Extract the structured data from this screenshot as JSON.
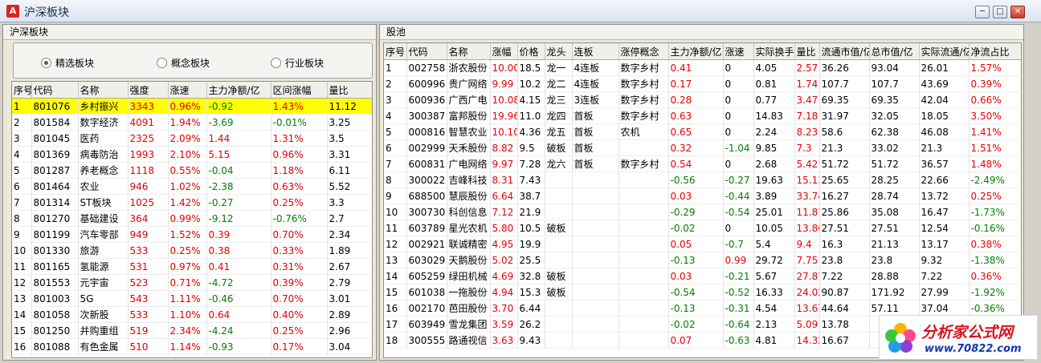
{
  "window": {
    "icon_text": "A",
    "title": "沪深板块",
    "min": "─",
    "max": "□",
    "close": "✕"
  },
  "left": {
    "title": "沪深板块",
    "radios": [
      {
        "label": "精选板块",
        "selected": true
      },
      {
        "label": "概念板块",
        "selected": false
      },
      {
        "label": "行业板块",
        "selected": false
      }
    ],
    "columns": [
      "序号",
      "代码",
      "名称",
      "强度",
      "涨速",
      "主力净额/亿",
      "区间涨幅",
      "量比"
    ],
    "rows": [
      [
        "1",
        "801076",
        "乡村振兴",
        "3343",
        "0.96%",
        "-0.92",
        "1.43%",
        "11.12"
      ],
      [
        "2",
        "801584",
        "数字经济",
        "4091",
        "1.94%",
        "-3.69",
        "-0.01%",
        "3.25"
      ],
      [
        "3",
        "801045",
        "医药",
        "2325",
        "2.09%",
        "1.44",
        "1.31%",
        "3.5"
      ],
      [
        "4",
        "801369",
        "病毒防治",
        "1993",
        "2.10%",
        "5.15",
        "0.96%",
        "3.31"
      ],
      [
        "5",
        "801287",
        "养老概念",
        "1118",
        "0.55%",
        "-0.04",
        "1.18%",
        "6.11"
      ],
      [
        "6",
        "801464",
        "农业",
        "946",
        "1.02%",
        "-2.38",
        "0.63%",
        "5.52"
      ],
      [
        "7",
        "801314",
        "ST板块",
        "1025",
        "1.42%",
        "-0.27",
        "0.25%",
        "3.3"
      ],
      [
        "8",
        "801270",
        "基础建设",
        "364",
        "0.99%",
        "-9.12",
        "-0.76%",
        "2.7"
      ],
      [
        "9",
        "801199",
        "汽车零部",
        "949",
        "1.52%",
        "0.39",
        "0.70%",
        "2.34"
      ],
      [
        "10",
        "801330",
        "旅游",
        "533",
        "0.25%",
        "0.38",
        "0.33%",
        "1.89"
      ],
      [
        "11",
        "801165",
        "氢能源",
        "531",
        "0.97%",
        "0.41",
        "0.31%",
        "2.67"
      ],
      [
        "12",
        "801553",
        "元宇宙",
        "523",
        "0.71%",
        "-4.72",
        "0.39%",
        "2.79"
      ],
      [
        "13",
        "801003",
        "5G",
        "543",
        "1.11%",
        "-0.46",
        "0.70%",
        "3.01"
      ],
      [
        "14",
        "801058",
        "次新股",
        "533",
        "1.10%",
        "0.64",
        "0.40%",
        "2.89"
      ],
      [
        "15",
        "801250",
        "并购重组",
        "519",
        "2.34%",
        "-4.24",
        "0.25%",
        "2.96"
      ],
      [
        "16",
        "801088",
        "有色金属",
        "510",
        "1.14%",
        "-0.93",
        "0.17%",
        "3.04"
      ]
    ]
  },
  "right": {
    "title": "股池",
    "columns": [
      "序号",
      "代码",
      "名称",
      "涨幅",
      "价格",
      "龙头",
      "连板",
      "涨停概念",
      "主力净额/亿",
      "涨速",
      "实际换手",
      "量比",
      "流通市值/亿",
      "总市值/亿",
      "实际流通/亿",
      "净流占比"
    ],
    "rows": [
      [
        "1",
        "002758",
        "浙农股份",
        "10.00",
        "18.5",
        "龙一",
        "4连板",
        "数字乡村",
        "0.41",
        "0",
        "4.05",
        "2.57",
        "36.26",
        "93.04",
        "26.01",
        "1.57%"
      ],
      [
        "2",
        "600996",
        "贵广网络",
        "9.99",
        "10.2",
        "龙二",
        "4连板",
        "数字乡村",
        "0.17",
        "0",
        "0.81",
        "1.74",
        "107.7",
        "107.7",
        "43.69",
        "0.39%"
      ],
      [
        "3",
        "600936",
        "广西广电",
        "10.08",
        "4.15",
        "龙三",
        "3连板",
        "数字乡村",
        "0.28",
        "0",
        "0.77",
        "3.47",
        "69.35",
        "69.35",
        "42.04",
        "0.66%"
      ],
      [
        "4",
        "300387",
        "富邦股份",
        "19.96",
        "11.0",
        "龙四",
        "首板",
        "数字乡村",
        "0.63",
        "0",
        "14.83",
        "7.18",
        "31.97",
        "32.05",
        "18.05",
        "3.50%"
      ],
      [
        "5",
        "000816",
        "智慧农业",
        "10.10",
        "4.36",
        "龙五",
        "首板",
        "农机",
        "0.65",
        "0",
        "2.24",
        "8.23",
        "58.6",
        "62.38",
        "46.08",
        "1.41%"
      ],
      [
        "6",
        "002999",
        "天禾股份",
        "8.82",
        "9.5",
        "破板",
        "首板",
        "",
        "0.32",
        "-1.04",
        "9.85",
        "7.3",
        "21.3",
        "33.02",
        "21.3",
        "1.51%"
      ],
      [
        "7",
        "600831",
        "广电网络",
        "9.97",
        "7.28",
        "龙六",
        "首板",
        "数字乡村",
        "0.54",
        "0",
        "2.68",
        "5.42",
        "51.72",
        "51.72",
        "36.57",
        "1.48%"
      ],
      [
        "8",
        "300022",
        "吉峰科技",
        "8.31",
        "7.43",
        "",
        "",
        "",
        "-0.56",
        "-0.27",
        "19.63",
        "15.13",
        "25.65",
        "28.25",
        "22.66",
        "-2.49%"
      ],
      [
        "9",
        "688500",
        "慧辰股份",
        "6.64",
        "38.7",
        "",
        "",
        "",
        "0.03",
        "-0.44",
        "3.89",
        "33.74",
        "16.27",
        "28.74",
        "13.72",
        "0.25%"
      ],
      [
        "10",
        "300730",
        "科创信息",
        "7.12",
        "21.9",
        "",
        "",
        "",
        "-0.29",
        "-0.54",
        "25.01",
        "11.87",
        "25.86",
        "35.08",
        "16.47",
        "-1.73%"
      ],
      [
        "11",
        "603789",
        "星光农机",
        "5.80",
        "10.5",
        "破板",
        "",
        "",
        "-0.02",
        "0",
        "10.05",
        "13.86",
        "27.51",
        "27.51",
        "12.54",
        "-0.16%"
      ],
      [
        "12",
        "002921",
        "联诚精密",
        "4.95",
        "19.9",
        "",
        "",
        "",
        "0.05",
        "-0.7",
        "5.4",
        "9.4",
        "16.3",
        "21.13",
        "13.17",
        "0.38%"
      ],
      [
        "13",
        "603029",
        "天鹅股份",
        "5.02",
        "25.5",
        "",
        "",
        "",
        "-0.13",
        "0.99",
        "29.72",
        "7.75",
        "23.8",
        "23.8",
        "9.32",
        "-1.38%"
      ],
      [
        "14",
        "605259",
        "绿田机械",
        "4.69",
        "32.8",
        "破板",
        "",
        "",
        "0.03",
        "-0.21",
        "5.67",
        "27.87",
        "7.22",
        "28.88",
        "7.22",
        "0.36%"
      ],
      [
        "15",
        "601038",
        "一拖股份",
        "4.94",
        "15.3",
        "破板",
        "",
        "",
        "-0.54",
        "-0.52",
        "16.33",
        "24.02",
        "90.87",
        "171.92",
        "27.99",
        "-1.92%"
      ],
      [
        "16",
        "002170",
        "芭田股份",
        "3.70",
        "6.44",
        "",
        "",
        "",
        "-0.13",
        "-0.31",
        "4.54",
        "13.67",
        "44.64",
        "57.11",
        "37.04",
        "-0.36%"
      ],
      [
        "17",
        "603949",
        "雪龙集团",
        "3.59",
        "26.2",
        "",
        "",
        "",
        "-0.02",
        "-0.64",
        "2.13",
        "5.09",
        "13.78",
        "",
        "",
        ""
      ],
      [
        "18",
        "300555",
        "路通视信",
        "3.63",
        "9.43",
        "",
        "",
        "",
        "0.07",
        "-0.63",
        "4.81",
        "14.32",
        "16.67",
        "",
        "",
        ""
      ]
    ]
  },
  "watermark": {
    "title": "分析家公式网",
    "url": "www.70822.com"
  },
  "colors": {
    "highlight": "#ffff00",
    "up": "#e60000",
    "down": "#008000"
  }
}
